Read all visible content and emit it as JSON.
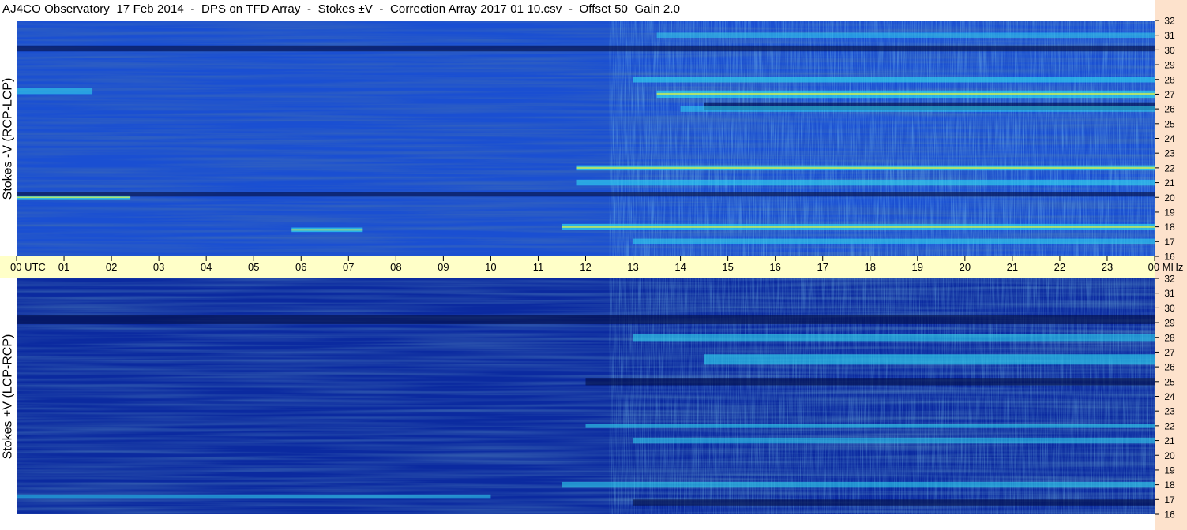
{
  "title": "AJ4CO Observatory  17 Feb 2014  -  DPS on TFD Array  -  Stokes ±V  -  Correction Array 2017 01 10.csv  -  Offset 50  Gain 2.0",
  "colors": {
    "time_band": "#ffffc8",
    "freq_strip": "#fde2cc",
    "top_base": "#1a4fd2",
    "bottom_base": "#0b2aa0",
    "activity_cyan": "#2fd6f0",
    "activity_yellow": "#d8f04a",
    "dark_band": "#03104a"
  },
  "chart_data": {
    "type": "heatmap",
    "title": "AJ4CO Observatory  17 Feb 2014  -  DPS on TFD Array  -  Stokes ±V  -  Correction Array 2017 01 10.csv  -  Offset 50  Gain 2.0",
    "x_ticks": [
      "00 UTC",
      "01",
      "02",
      "03",
      "04",
      "05",
      "06",
      "07",
      "08",
      "09",
      "10",
      "11",
      "12",
      "13",
      "14",
      "15",
      "16",
      "17",
      "18",
      "19",
      "20",
      "21",
      "22",
      "23",
      "00 MHz"
    ],
    "xlim": [
      0,
      24
    ],
    "y_ticks": [
      "16",
      "17",
      "18",
      "19",
      "20",
      "21",
      "22",
      "23",
      "24",
      "25",
      "26",
      "27",
      "28",
      "29",
      "30",
      "31",
      "32"
    ],
    "ylim": [
      16,
      32
    ],
    "panels": [
      {
        "name": "top",
        "ylabel": "Stokes -V (RCP-LCP)",
        "base_color": "#1a4fd2",
        "bands": [
          {
            "mhz": 31.0,
            "width": 0.35,
            "strength": 0.4,
            "t0": 13.5,
            "t1": 24
          },
          {
            "mhz": 28.0,
            "width": 0.4,
            "strength": 0.7,
            "t0": 13.0,
            "t1": 24
          },
          {
            "mhz": 27.0,
            "width": 0.5,
            "strength": 0.9,
            "t0": 13.5,
            "t1": 24
          },
          {
            "mhz": 27.2,
            "width": 0.4,
            "strength": 0.6,
            "t0": 0.0,
            "t1": 1.6
          },
          {
            "mhz": 26.0,
            "width": 0.4,
            "strength": 0.5,
            "t0": 14.0,
            "t1": 24
          },
          {
            "mhz": 22.0,
            "width": 0.35,
            "strength": 1.0,
            "t0": 11.8,
            "t1": 24
          },
          {
            "mhz": 21.0,
            "width": 0.4,
            "strength": 0.7,
            "t0": 11.8,
            "t1": 24
          },
          {
            "mhz": 20.0,
            "width": 0.25,
            "strength": 1.0,
            "t0": 0.0,
            "t1": 2.4
          },
          {
            "mhz": 18.0,
            "width": 0.4,
            "strength": 0.9,
            "t0": 11.5,
            "t1": 24
          },
          {
            "mhz": 17.8,
            "width": 0.3,
            "strength": 0.9,
            "t0": 5.8,
            "t1": 7.3
          },
          {
            "mhz": 17.0,
            "width": 0.4,
            "strength": 0.6,
            "t0": 13.0,
            "t1": 24
          }
        ],
        "dark_bands": [
          {
            "mhz": 26.2,
            "width": 0.5,
            "t0": 14.5,
            "t1": 24
          },
          {
            "mhz": 30.1,
            "width": 0.4,
            "t0": 0.0,
            "t1": 24
          },
          {
            "mhz": 20.2,
            "width": 0.3,
            "t0": 0.0,
            "t1": 24
          }
        ]
      },
      {
        "name": "bottom",
        "ylabel": "Stokes +V (LCP-RCP)",
        "base_color": "#0b2aa0",
        "bands": [
          {
            "mhz": 28.0,
            "width": 0.5,
            "strength": 0.6,
            "t0": 13.0,
            "t1": 24
          },
          {
            "mhz": 26.5,
            "width": 0.7,
            "strength": 0.7,
            "t0": 14.5,
            "t1": 24
          },
          {
            "mhz": 22.0,
            "width": 0.3,
            "strength": 0.6,
            "t0": 12.0,
            "t1": 24
          },
          {
            "mhz": 21.0,
            "width": 0.4,
            "strength": 0.5,
            "t0": 13.0,
            "t1": 24
          },
          {
            "mhz": 18.0,
            "width": 0.4,
            "strength": 0.6,
            "t0": 11.5,
            "t1": 24
          },
          {
            "mhz": 17.2,
            "width": 0.3,
            "strength": 0.5,
            "t0": 0.0,
            "t1": 10.0
          }
        ],
        "dark_bands": [
          {
            "mhz": 29.2,
            "width": 0.6,
            "t0": 0.0,
            "t1": 24
          },
          {
            "mhz": 25.0,
            "width": 0.5,
            "t0": 12.0,
            "t1": 24
          },
          {
            "mhz": 16.8,
            "width": 0.4,
            "t0": 13.0,
            "t1": 24
          }
        ]
      }
    ]
  }
}
